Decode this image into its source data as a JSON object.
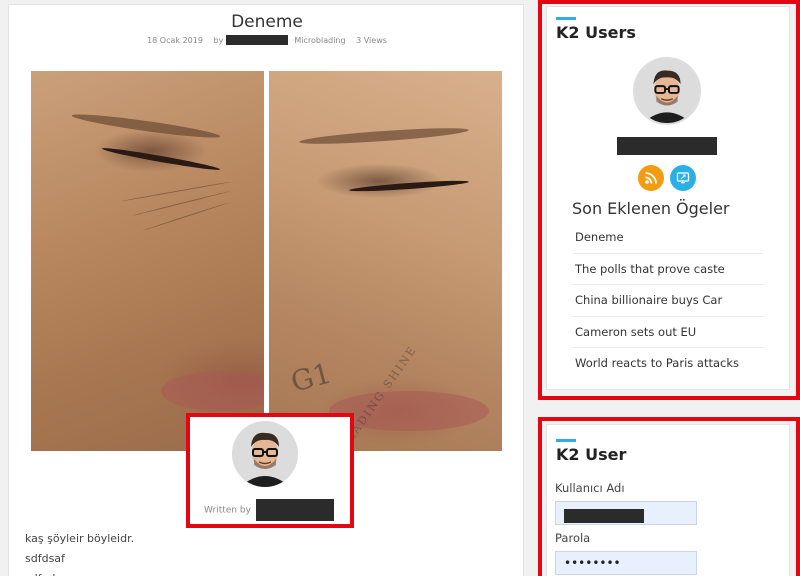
{
  "article": {
    "title": "Deneme",
    "date": "18 Ocak 2019",
    "by_label": "by",
    "category": "Microblading",
    "views": "3 Views",
    "watermark": "G1",
    "watermark_sub": "BLADING SHINE",
    "written_by": "Written by",
    "body_lines": [
      "kaş şöyleir böyleidr.",
      "sdfdsaf",
      "sdfads"
    ]
  },
  "k2_users": {
    "title": "K2 Users",
    "icons": [
      "rss-icon",
      "website-icon"
    ],
    "section_title": "Son Eklenen Ögeler",
    "recent_items": [
      "Deneme",
      "The polls that prove caste",
      "China billionaire buys Car",
      "Cameron sets out EU",
      "World reacts to Paris attacks"
    ]
  },
  "k2_user": {
    "title": "K2 User",
    "username_label": "Kullanıcı Adı",
    "password_label": "Parola",
    "password_value": "••••••••"
  },
  "colors": {
    "highlight": "#e30613",
    "accent": "#2ab0e5",
    "rss": "#f39c12"
  }
}
